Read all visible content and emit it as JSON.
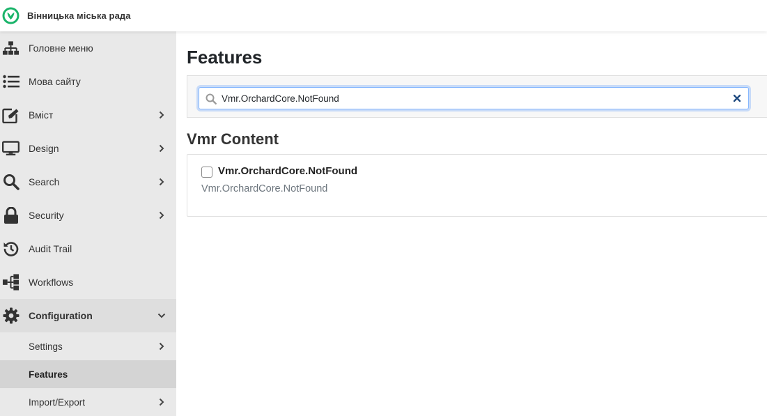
{
  "header": {
    "site_name": "Вінницька міська рада",
    "logo_icon": "leaf-logo-icon",
    "logo_color": "#1ab46a"
  },
  "sidebar": {
    "items": [
      {
        "label": "Головне меню",
        "icon": "sitemap-icon"
      },
      {
        "label": "Мова сайту",
        "icon": "list-icon"
      },
      {
        "label": "Вміст",
        "icon": "edit-icon",
        "has_children": true
      },
      {
        "label": "Design",
        "icon": "monitor-icon",
        "has_children": true
      },
      {
        "label": "Search",
        "icon": "search-icon",
        "has_children": true
      },
      {
        "label": "Security",
        "icon": "lock-icon",
        "has_children": true
      },
      {
        "label": "Audit Trail",
        "icon": "history-icon"
      },
      {
        "label": "Workflows",
        "icon": "workflow-icon"
      },
      {
        "label": "Configuration",
        "icon": "gear-icon",
        "has_children": true,
        "expanded": true
      }
    ],
    "sub_items": [
      {
        "label": "Settings",
        "has_children": true
      },
      {
        "label": "Features",
        "active": true
      },
      {
        "label": "Import/Export",
        "has_children": true
      }
    ]
  },
  "main": {
    "title": "Features",
    "search": {
      "value": "Vmr.OrchardCore.NotFound",
      "placeholder": ""
    },
    "group_title": "Vmr Content",
    "feature": {
      "name": "Vmr.OrchardCore.NotFound",
      "description": "Vmr.OrchardCore.NotFound",
      "enabled": false
    }
  },
  "colors": {
    "sidebar_bg": "#e9e9e9",
    "active_bg": "#d4d4d4",
    "focus_border": "#86b7fe",
    "muted_text": "#6c757d"
  }
}
